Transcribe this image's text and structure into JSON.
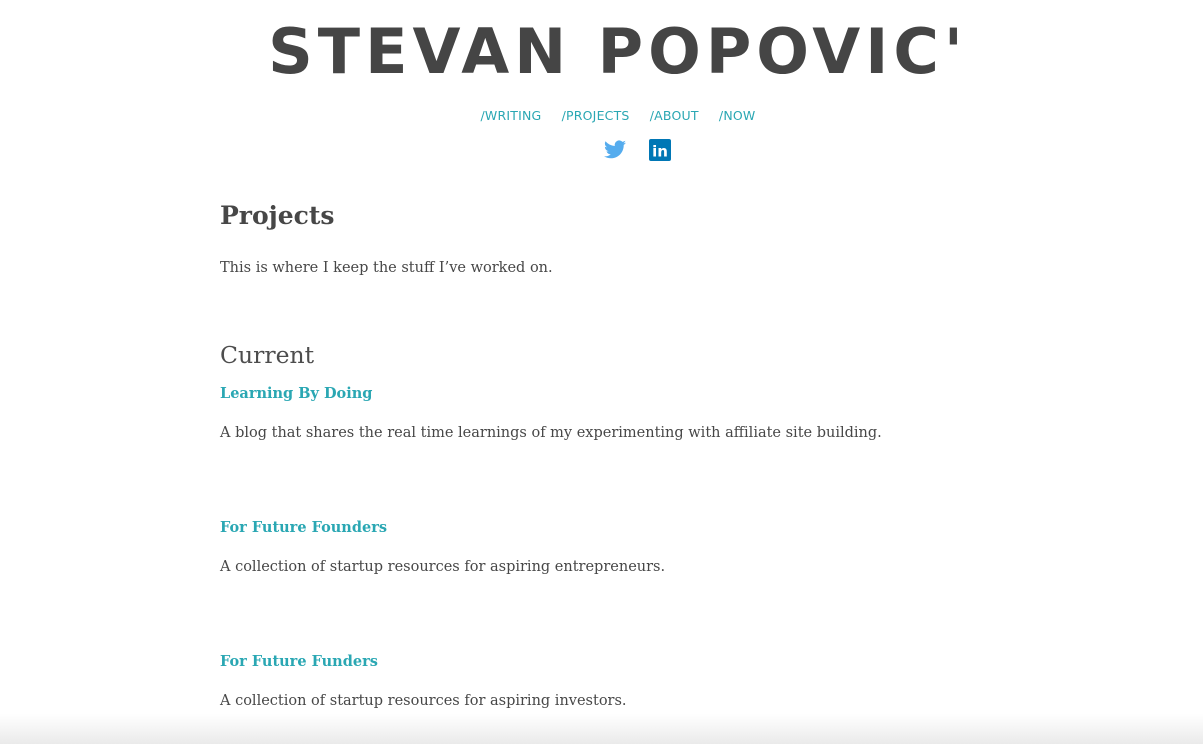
{
  "header": {
    "site_title": "STEVAN POPOVIC'"
  },
  "nav": {
    "items": [
      {
        "label": "/WRITING"
      },
      {
        "label": "/PROJECTS"
      },
      {
        "label": "/ABOUT"
      },
      {
        "label": "/NOW"
      }
    ],
    "link_color": "#2aa7b3"
  },
  "social": {
    "icons": [
      "twitter-icon",
      "linkedin-icon"
    ],
    "twitter_color": "#55acee",
    "linkedin_color": "#0077b5",
    "linkedin_text": "in"
  },
  "main": {
    "page_title": "Projects",
    "intro": "This is where I keep the stuff I’ve worked on.",
    "section_heading": "Current",
    "projects": [
      {
        "title": "Learning By Doing",
        "description": "A blog that shares the real time learnings of my experimenting with affiliate site building."
      },
      {
        "title": "For Future Founders",
        "description": "A collection of startup resources for aspiring entrepreneurs."
      },
      {
        "title": "For Future Funders",
        "description": "A collection of startup resources for aspiring investors."
      }
    ]
  }
}
